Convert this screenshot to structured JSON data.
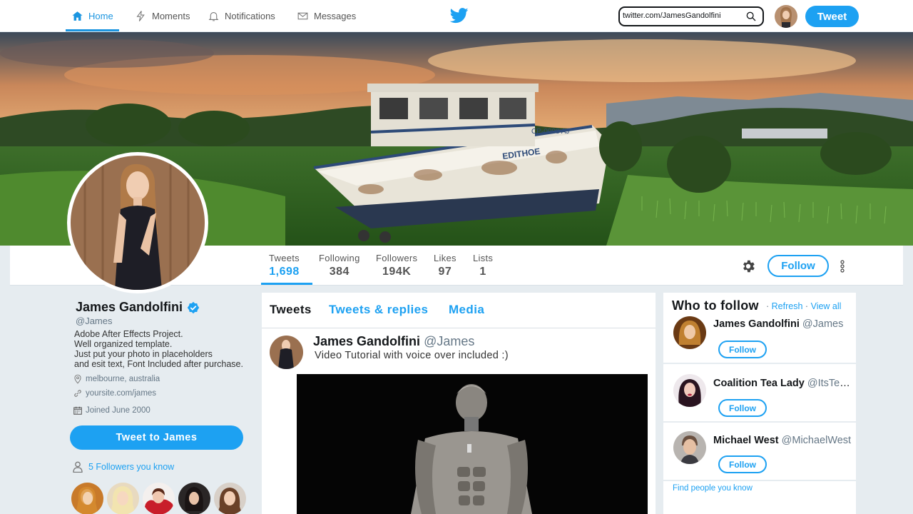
{
  "nav": {
    "home": "Home",
    "moments": "Moments",
    "notifications": "Notifications",
    "messages": "Messages",
    "search_value": "twitter.com/JamesGandolfini",
    "tweet_button": "Tweet"
  },
  "profile": {
    "name": "James Gandolfini",
    "handle": "@James",
    "bio": [
      "Adobe After Effects Project.",
      "Well organized template.",
      "Just put your photo in placeholders",
      "and esit text, Font Included after purchase."
    ],
    "location": "melbourne, australia",
    "website": "yoursite.com/james",
    "joined": "Joined June 2000",
    "tweet_to": "Tweet to James",
    "followers_you_know": "5 Followers you know"
  },
  "stats": [
    {
      "label": "Tweets",
      "value": "1,698"
    },
    {
      "label": "Following",
      "value": "384"
    },
    {
      "label": "Followers",
      "value": "194K"
    },
    {
      "label": "Likes",
      "value": "97"
    },
    {
      "label": "Lists",
      "value": "1"
    }
  ],
  "follow_button": "Follow",
  "tabs": {
    "tweets": "Tweets",
    "replies": "Tweets & replies",
    "media": "Media"
  },
  "tweet": {
    "name": "James Gandolfini",
    "handle": "@James",
    "text": "Video Tutorial with voice over included  :)"
  },
  "who_to_follow": {
    "title": "Who to follow",
    "dot1": "·",
    "refresh": "Refresh",
    "dot2": "·",
    "view_all": "View all",
    "items": [
      {
        "name": "James Gandolfini",
        "handle": "@James",
        "follow": "Follow"
      },
      {
        "name": "Coalition Tea Lady",
        "handle": "@ItsTeaLady",
        "follow": "Follow"
      },
      {
        "name": "Michael West",
        "handle": "@MichaelWest",
        "follow": "Follow"
      }
    ],
    "find_people": "Find people you know"
  },
  "colors": {
    "accent": "#1da1f2",
    "background": "#e6ecf0"
  }
}
